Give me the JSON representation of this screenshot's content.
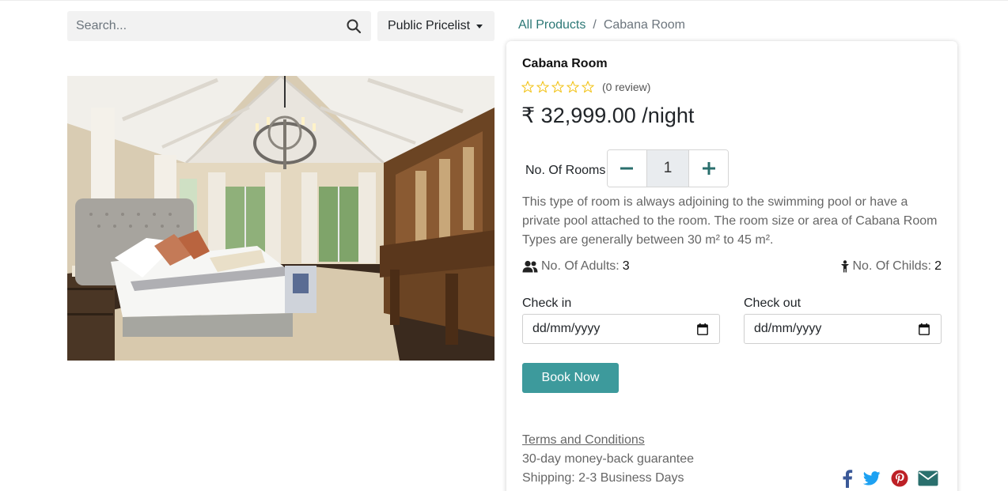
{
  "search": {
    "placeholder": "Search..."
  },
  "pricelist": {
    "label": "Public Pricelist"
  },
  "breadcrumb": {
    "parent": "All Products",
    "separator": "/",
    "current": "Cabana Room"
  },
  "product": {
    "title": "Cabana Room",
    "rating_count": "(0 review)",
    "stars_filled": 0,
    "stars_total": 5,
    "price": "₹ 32,999.00 /night",
    "rooms_label": "No. Of Rooms",
    "quantity": "1",
    "description": "This type of room is always adjoining to the swimming pool or have a private pool attached to the room. The room size or area of Cabana Room Types are generally between 30 m² to 45 m².",
    "adults_label": "No. Of Adults:",
    "adults_value": "3",
    "childs_label": "No. Of Childs:",
    "childs_value": "2"
  },
  "booking": {
    "checkin_label": "Check in",
    "checkin_value": "dd/mm/yyyy",
    "checkout_label": "Check out",
    "checkout_value": "dd/mm/yyyy",
    "book_label": "Book Now"
  },
  "footer": {
    "terms": "Terms and Conditions",
    "guarantee": "30-day money-back guarantee",
    "shipping": "Shipping: 2-3 Business Days"
  },
  "social": [
    "facebook-icon",
    "twitter-icon",
    "pinterest-icon",
    "envelope-icon"
  ],
  "colors": {
    "accent": "#3d9a9c",
    "link": "#2d7876",
    "star": "#f3c623",
    "facebook": "#3b5998",
    "twitter": "#1da1f2",
    "pinterest": "#bd2026",
    "email": "#2a6f6d"
  }
}
